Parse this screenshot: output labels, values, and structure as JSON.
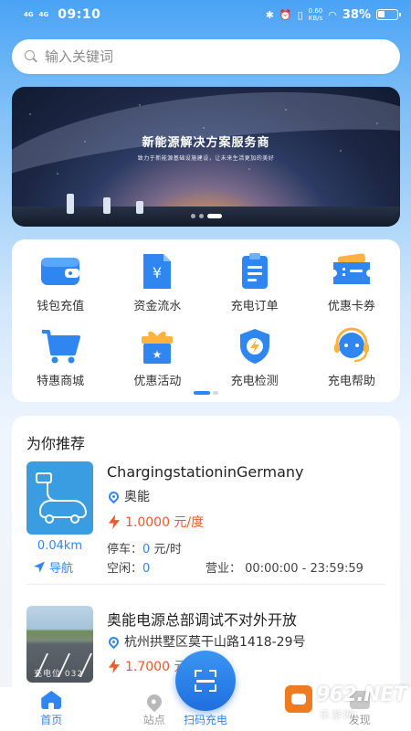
{
  "status_bar": {
    "network_1": "4G",
    "network_2": "4G",
    "time": "09:10",
    "speed_value": "0.60",
    "speed_unit": "KB/s",
    "battery": "38%"
  },
  "search": {
    "placeholder": "输入关键词"
  },
  "banner": {
    "title": "新能源解决方案服务商",
    "subtitle": "致力于新能源基础设施建设，让未来生活更加的美好"
  },
  "menu": {
    "items": [
      {
        "label": "钱包充值",
        "icon": "wallet-icon"
      },
      {
        "label": "资金流水",
        "icon": "yuan-document-icon"
      },
      {
        "label": "充电订单",
        "icon": "order-clipboard-icon"
      },
      {
        "label": "优惠卡券",
        "icon": "coupon-ticket-icon"
      },
      {
        "label": "特惠商城",
        "icon": "shopping-cart-icon"
      },
      {
        "label": "优惠活动",
        "icon": "gift-box-icon"
      },
      {
        "label": "充电检测",
        "icon": "shield-bolt-icon"
      },
      {
        "label": "充电帮助",
        "icon": "headset-icon"
      }
    ]
  },
  "recommend": {
    "title": "为你推荐",
    "stations": [
      {
        "name": "ChargingstationinGermany",
        "operator": "奥能",
        "price": "1.0000 元/度",
        "distance": "0.04km",
        "nav_label": "导航",
        "parking_label": "停车：",
        "parking_value": "0",
        "parking_unit": "元/时",
        "idle_label": "空闲：",
        "idle_value": "0",
        "hours_label": "营业：",
        "hours_value": "00:00:00 - 23:59:59"
      },
      {
        "name": "奥能电源总部调试不对外开放",
        "address": "杭州拱墅区莫干山路1418-29号",
        "price": "1.7000 元/度",
        "lot_text": "充电位 032"
      }
    ]
  },
  "tabbar": {
    "tabs": [
      {
        "label": "首页",
        "icon": "home-icon",
        "active": true
      },
      {
        "label": "站点",
        "icon": "location-pin-icon",
        "active": false
      },
      {
        "label": "扫码充电",
        "icon": "scan-icon",
        "active": false
      },
      {
        "label": "发现",
        "icon": "discover-icon",
        "active": false
      }
    ]
  },
  "watermark": {
    "text": "962.NET",
    "sub": "乐游网"
  },
  "colors": {
    "accent": "#2f86f0",
    "price": "#f0572b",
    "background_top": "#4aa3f5"
  }
}
